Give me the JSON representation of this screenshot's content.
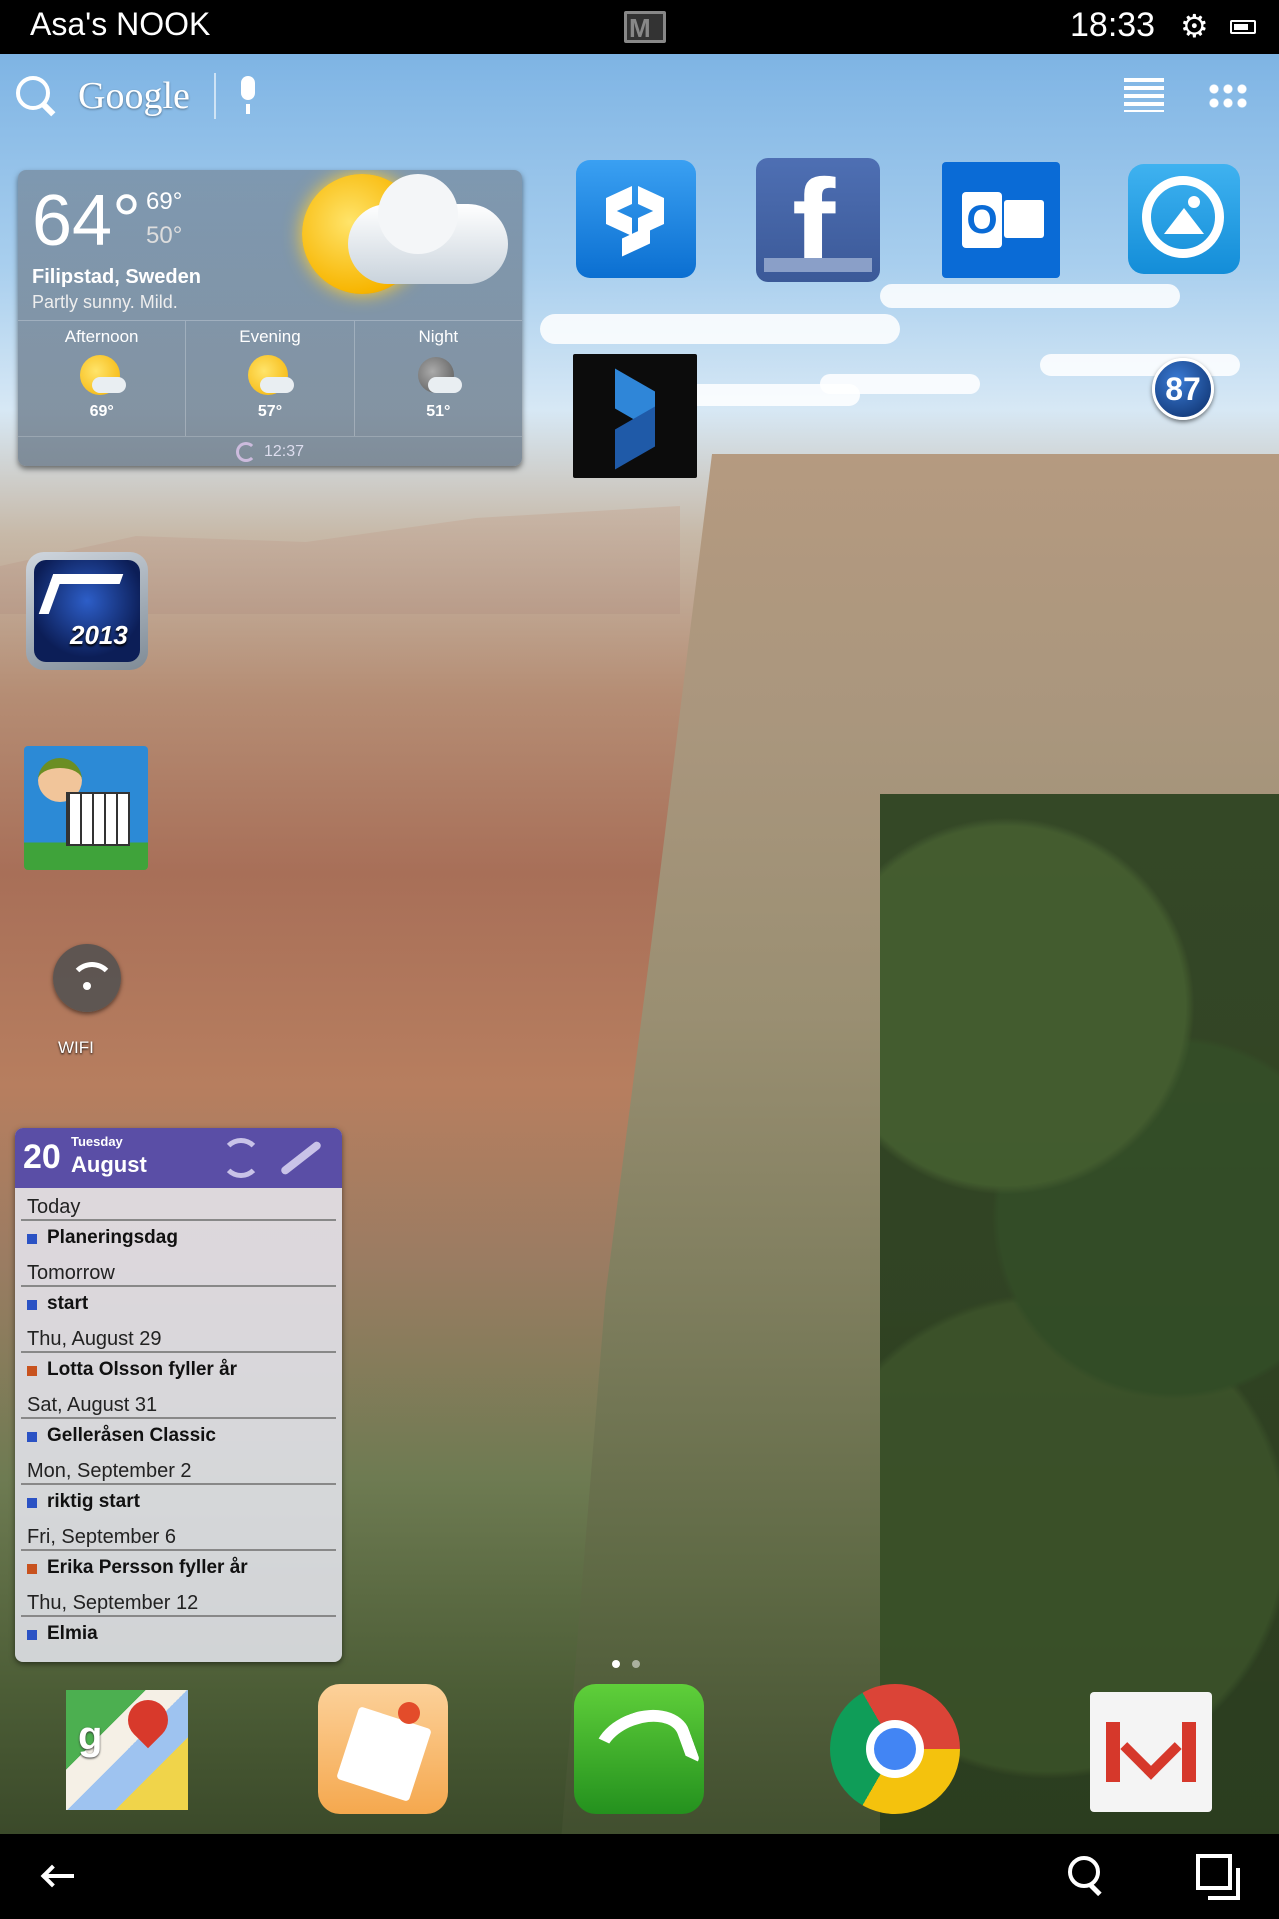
{
  "status_bar": {
    "device_name": "Asa's NOOK",
    "time": "18:33",
    "icons": [
      "gmail-notification-icon",
      "settings-icon",
      "battery-icon"
    ]
  },
  "search_bar": {
    "label": "Google",
    "icons": [
      "search-icon",
      "mic-icon",
      "list-view-icon",
      "apps-grid-icon"
    ]
  },
  "weather": {
    "temp": "64°",
    "high": "69°",
    "low": "50°",
    "location": "Filipstad, Sweden",
    "condition": "Partly sunny. Mild.",
    "forecast": [
      {
        "label": "Afternoon",
        "temp": "69°",
        "icon": "sun-cloud-icon"
      },
      {
        "label": "Evening",
        "temp": "57°",
        "icon": "sun-cloud-icon"
      },
      {
        "label": "Night",
        "temp": "51°",
        "icon": "moon-cloud-icon"
      }
    ],
    "updated": "12:37"
  },
  "apps": {
    "row1": [
      "dropbox-icon",
      "facebook-icon",
      "outlook-icon",
      "quickpic-icon"
    ],
    "badge_value": "87",
    "facebook_letter": "f",
    "outlook_letter": "O",
    "maps_letter": "g",
    "motogp_label": "2013",
    "wifi_label": "WIFI"
  },
  "calendar": {
    "day": "20",
    "weekday": "Tuesday",
    "month": "August",
    "entries": [
      {
        "date": "Today",
        "event": "Planeringsdag",
        "color": "#2b52c4"
      },
      {
        "date": "Tomorrow",
        "event": "start",
        "color": "#2b52c4"
      },
      {
        "date": "Thu, August 29",
        "event": "Lotta Olsson fyller år",
        "color": "#c8521e"
      },
      {
        "date": "Sat, August 31",
        "event": "Gelleråsen Classic",
        "color": "#2b52c4"
      },
      {
        "date": "Mon, September 2",
        "event": "riktig start",
        "color": "#2b52c4"
      },
      {
        "date": "Fri, September 6",
        "event": "Erika Persson fyller år",
        "color": "#c8521e"
      },
      {
        "date": "Thu, September 12",
        "event": "Elmia",
        "color": "#2b52c4"
      }
    ]
  },
  "dock": [
    "maps-icon",
    "notes-icon",
    "dolphin-browser-icon",
    "chrome-icon",
    "gmail-icon"
  ],
  "nav_bar": [
    "back-icon",
    "search-icon",
    "recent-apps-icon"
  ]
}
